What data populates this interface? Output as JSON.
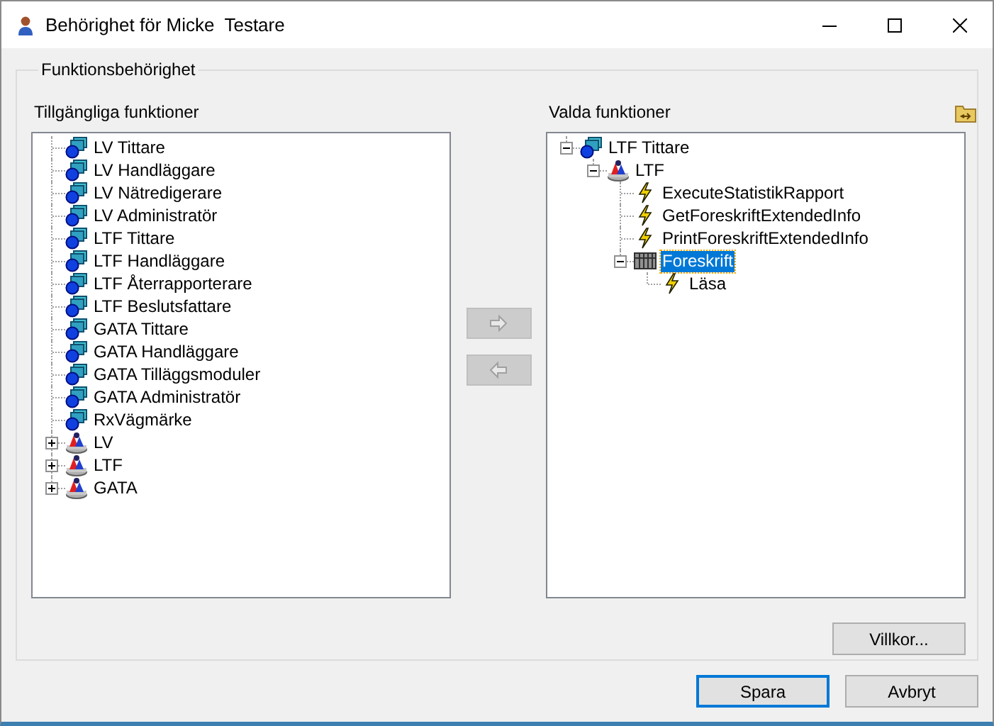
{
  "window": {
    "title": "Behörighet för Micke  Testare"
  },
  "group": {
    "title": "Funktionsbehörighet"
  },
  "available": {
    "label": "Tillgängliga funktioner",
    "items": [
      {
        "kind": "role",
        "label": "LV Tittare",
        "selected": false
      },
      {
        "kind": "role",
        "label": "LV Handläggare",
        "selected": false
      },
      {
        "kind": "role",
        "label": "LV Nätredigerare",
        "selected": false
      },
      {
        "kind": "role",
        "label": "LV Administratör",
        "selected": false
      },
      {
        "kind": "role",
        "label": "LTF Tittare",
        "selected": false
      },
      {
        "kind": "role",
        "label": "LTF Handläggare",
        "selected": false
      },
      {
        "kind": "role",
        "label": "LTF Återrapporterare",
        "selected": false
      },
      {
        "kind": "role",
        "label": "LTF Beslutsfattare",
        "selected": false
      },
      {
        "kind": "role",
        "label": "GATA Tittare",
        "selected": false
      },
      {
        "kind": "role",
        "label": "GATA Handläggare",
        "selected": false
      },
      {
        "kind": "role",
        "label": "GATA Tilläggsmoduler",
        "selected": false
      },
      {
        "kind": "role",
        "label": "GATA Administratör",
        "selected": false
      },
      {
        "kind": "role",
        "label": "RxVägmärke",
        "selected": false
      },
      {
        "kind": "group",
        "label": "LV",
        "expanded": false,
        "selected": false
      },
      {
        "kind": "group",
        "label": "LTF",
        "expanded": false,
        "selected": false
      },
      {
        "kind": "group",
        "label": "GATA",
        "expanded": false,
        "selected": false
      }
    ]
  },
  "transfer_buttons": [
    {
      "kind": "add",
      "disabled": true
    },
    {
      "kind": "remove",
      "disabled": true
    }
  ],
  "chosen": {
    "label": "Valda funktioner",
    "items": [
      {
        "kind": "role",
        "label": "LTF Tittare",
        "expanded": true,
        "selected": false,
        "children": [
          {
            "kind": "group",
            "label": "LTF",
            "expanded": true,
            "selected": false,
            "children": [
              {
                "kind": "function",
                "label": "ExecuteStatistikRapport",
                "selected": false
              },
              {
                "kind": "function",
                "label": "GetForeskriftExtendedInfo",
                "selected": false
              },
              {
                "kind": "function",
                "label": "PrintForeskriftExtendedInfo",
                "selected": false
              },
              {
                "kind": "object",
                "label": "Foreskrift",
                "expanded": true,
                "selected": true,
                "children": [
                  {
                    "kind": "function",
                    "label": "Läsa",
                    "selected": false
                  }
                ]
              }
            ]
          }
        ]
      }
    ]
  },
  "conditions_button": "Villkor...",
  "buttons": [
    {
      "label": "Spara",
      "default": true
    },
    {
      "label": "Avbryt",
      "default": false
    }
  ]
}
